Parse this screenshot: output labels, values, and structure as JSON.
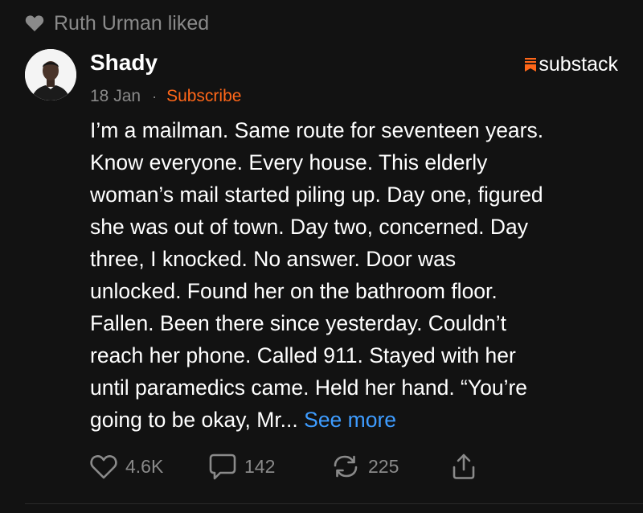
{
  "liked_by": "Ruth Urman liked",
  "post": {
    "author": "Shady",
    "date": "18 Jan",
    "separator": "·",
    "subscribe_label": "Subscribe",
    "platform": "substack",
    "body_lines": [
      "I’m a mailman. Same route for seventeen years.",
      "Know everyone. Every house. This elderly",
      "woman’s mail started piling up. Day one, figured",
      "she was out of town. Day two, concerned. Day",
      "three, I knocked. No answer. Door was",
      "unlocked. Found her on the bathroom floor.",
      "Fallen. Been there since yesterday. Couldn’t",
      "reach her phone. Called 911. Stayed with her",
      "until paramedics came. Held her hand. “You’re"
    ],
    "body_last": "going to be okay, Mr...",
    "see_more": "See more",
    "likes": "4.6K",
    "comments": "142",
    "restacks": "225"
  },
  "colors": {
    "background": "#121212",
    "muted": "#8a8a8a",
    "accent_orange": "#ff6719",
    "link_blue": "#3e9cff"
  },
  "icons": {
    "liked": "heart-icon",
    "platform": "substack-logo-icon",
    "like": "heart-outline-icon",
    "comment": "comment-bubble-icon",
    "restack": "restack-icon",
    "share": "share-icon"
  }
}
